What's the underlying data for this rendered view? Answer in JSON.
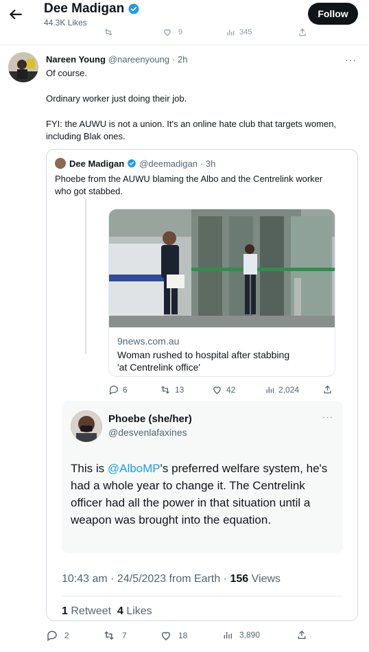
{
  "header": {
    "title": "Dee Madigan",
    "subtitle": "44.3K Likes",
    "follow_label": "Follow",
    "ghost_counts": {
      "likes": "9",
      "views": "345"
    }
  },
  "main_tweet": {
    "author_name": "Nareen Young",
    "author_handle": "@nareenyoung",
    "time": "· 2h",
    "lines": [
      "Of course.",
      "Ordinary worker just doing their job.",
      "FYI: the AUWU is not a union. It's an online hate club that targets women,",
      "including Blak ones."
    ],
    "more": "···"
  },
  "quote": {
    "author_name": "Dee Madigan",
    "author_handle": "@deemadigan",
    "time": "· 3h",
    "text_lines": [
      "Phoebe from the AUWU blaming the Albo and the Centrelink worker",
      "who got stabbed."
    ],
    "screenshot": {
      "card_domain": "9news.com.au",
      "card_title_lines": [
        "Woman rushed to hospital after stabbing",
        "'at Centrelink office'"
      ],
      "inner_actions": {
        "replies": "6",
        "retweets": "13",
        "likes": "42",
        "views": "2,024"
      },
      "inner_tweet": {
        "name": "Phoebe (she/her)",
        "handle": "@desvenlafaxines",
        "more": "···",
        "text_before": "This is ",
        "mention": "@AlboMP",
        "text_after": "'s preferred welfare system, he's had a whole year to change it. The Centrelink officer had all the power in that situation until a weapon was brought into the equation."
      },
      "time_text": "10:43 am · 24/5/2023 from Earth ·",
      "views_count": "156",
      "views_label": "Views",
      "retweet_count": "1",
      "retweet_label": "Retweet",
      "likes_count": "4",
      "likes_label": "Likes"
    }
  },
  "actions": {
    "replies": "2",
    "retweets": "7",
    "likes": "18",
    "views": "3,890"
  },
  "colors": {
    "accent": "#1d9bf0",
    "text": "#0f1419",
    "muted": "#536471",
    "follow_bg": "#0f1419"
  }
}
